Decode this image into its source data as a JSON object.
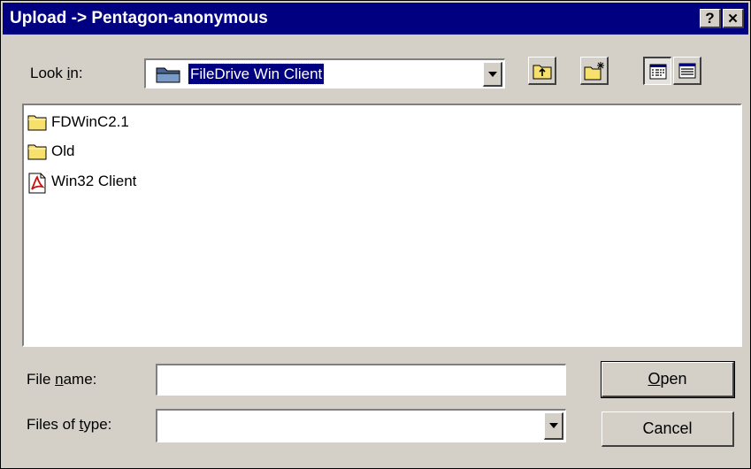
{
  "window": {
    "title": "Upload -> Pentagon-anonymous",
    "help_glyph": "?",
    "close_glyph": "✕"
  },
  "look_in": {
    "label_prefix": "Look ",
    "label_accel": "i",
    "label_suffix": "n:",
    "value": "FileDrive Win Client",
    "icon": "folder-open-icon"
  },
  "toolbar": {
    "buttons": [
      {
        "name": "up-one-level",
        "icon": "folder-up-icon"
      },
      {
        "name": "create-new-folder",
        "icon": "new-folder-icon"
      },
      {
        "name": "list-view",
        "icon": "list-view-icon"
      },
      {
        "name": "details-view",
        "icon": "details-view-icon"
      }
    ]
  },
  "files": [
    {
      "name": "FDWinC2.1",
      "icon": "folder-icon"
    },
    {
      "name": "Old",
      "icon": "folder-icon"
    },
    {
      "name": "Win32 Client",
      "icon": "pdf-file-icon"
    }
  ],
  "file_name": {
    "label_prefix": "File ",
    "label_accel": "n",
    "label_suffix": "ame:",
    "value": ""
  },
  "file_type": {
    "label_prefix": "Files of ",
    "label_accel": "t",
    "label_suffix": "ype:",
    "value": ""
  },
  "buttons": {
    "open_accel": "O",
    "open_rest": "pen",
    "cancel": "Cancel"
  },
  "colors": {
    "title_bar": "#000080",
    "face": "#d4d0c8",
    "selection": "#000080",
    "folder": "#f8e06c"
  }
}
